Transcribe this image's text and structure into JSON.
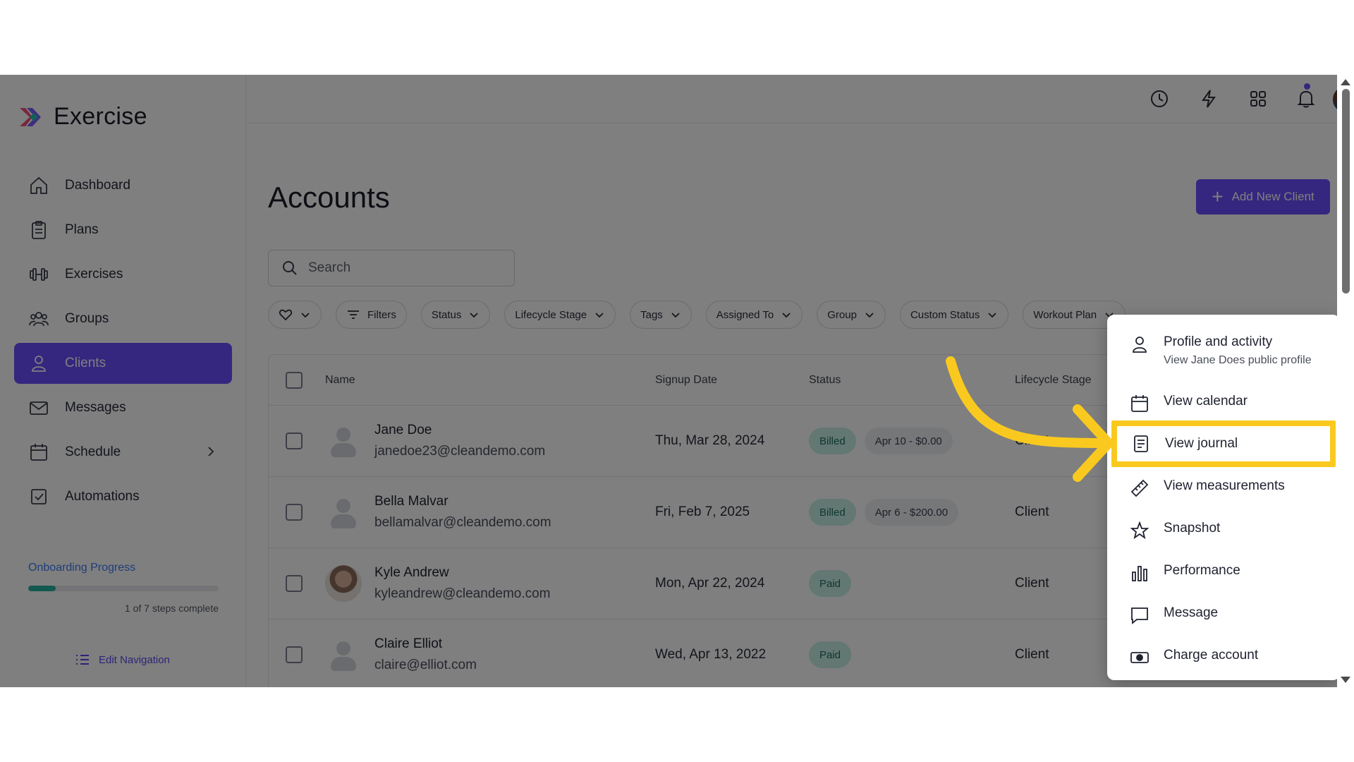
{
  "app": {
    "name": "Exercise"
  },
  "sidebar": {
    "items": [
      {
        "label": "Dashboard",
        "icon": "home-icon"
      },
      {
        "label": "Plans",
        "icon": "clipboard-icon"
      },
      {
        "label": "Exercises",
        "icon": "dumbbell-icon"
      },
      {
        "label": "Groups",
        "icon": "groups-icon"
      },
      {
        "label": "Clients",
        "icon": "user-icon",
        "active": true
      },
      {
        "label": "Messages",
        "icon": "mail-icon"
      },
      {
        "label": "Schedule",
        "icon": "calendar-icon"
      },
      {
        "label": "Automations",
        "icon": "checkbox-icon"
      }
    ],
    "onboarding": {
      "title": "Onboarding Progress",
      "steps_done": 1,
      "steps_total": 7,
      "note": "1 of 7 steps complete"
    },
    "edit_navigation": "Edit Navigation"
  },
  "page": {
    "title": "Accounts",
    "add_button": "Add New Client",
    "search_placeholder": "Search"
  },
  "filters": [
    "Filters",
    "Status",
    "Lifecycle Stage",
    "Tags",
    "Assigned To",
    "Group",
    "Custom Status",
    "Workout Plan"
  ],
  "table": {
    "headers": {
      "name": "Name",
      "signup": "Signup Date",
      "status": "Status",
      "stage": "Lifecycle Stage"
    },
    "rows": [
      {
        "name": "Jane Doe",
        "email": "janedoe23@cleandemo.com",
        "signup": "Thu, Mar 28, 2024",
        "status": "Billed",
        "amount": "Apr 10 - $0.00",
        "stage": "Client"
      },
      {
        "name": "Bella Malvar",
        "email": "bellamalvar@cleandemo.com",
        "signup": "Fri, Feb 7, 2025",
        "status": "Billed",
        "amount": "Apr 6 - $200.00",
        "stage": "Client"
      },
      {
        "name": "Kyle Andrew",
        "email": "kyleandrew@cleandemo.com",
        "signup": "Mon, Apr 22, 2024",
        "status": "Paid",
        "amount": "",
        "stage": "Client"
      },
      {
        "name": "Claire Elliot",
        "email": "claire@elliot.com",
        "signup": "Wed, Apr 13, 2022",
        "status": "Paid",
        "amount": "",
        "stage": "Client"
      }
    ]
  },
  "menu": {
    "items": [
      {
        "label": "Profile and activity",
        "sub": "View Jane Does public profile",
        "icon": "user-icon"
      },
      {
        "label": "View calendar",
        "icon": "calendar-icon"
      },
      {
        "label": "View journal",
        "icon": "journal-icon",
        "highlighted": true
      },
      {
        "label": "View measurements",
        "icon": "ruler-icon"
      },
      {
        "label": "Snapshot",
        "icon": "star-icon"
      },
      {
        "label": "Performance",
        "icon": "bar-chart-icon"
      },
      {
        "label": "Message",
        "icon": "chat-icon"
      },
      {
        "label": "Charge account",
        "icon": "cash-icon"
      }
    ]
  },
  "colors": {
    "accent": "#6a4fff",
    "highlight": "#f9c91f",
    "paid_bg": "#c7efe6"
  }
}
